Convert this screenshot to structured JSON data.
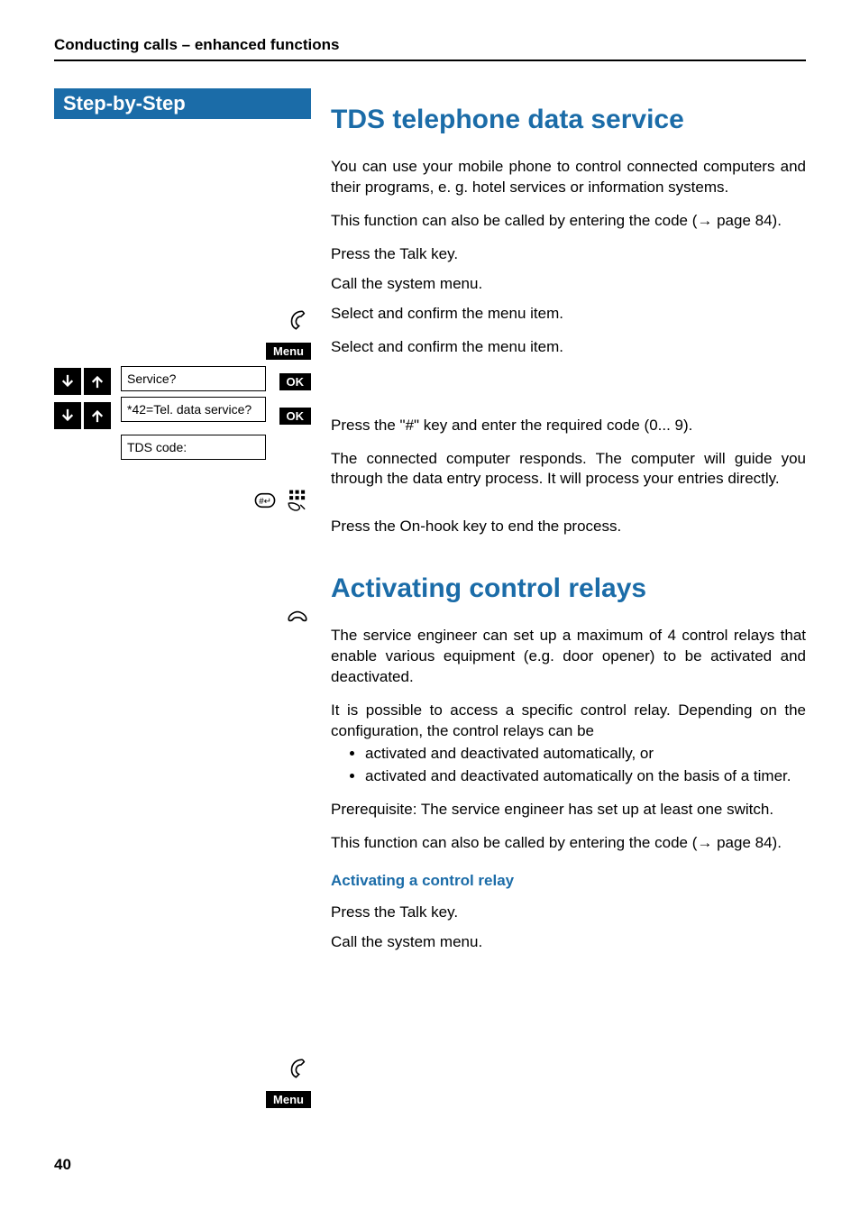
{
  "header": {
    "running_title": "Conducting calls – enhanced functions"
  },
  "left": {
    "step_by_step": "Step-by-Step",
    "menu_label": "Menu",
    "ok_label": "OK",
    "service_item": "Service?",
    "tel_data_item": "*42=Tel. data service?",
    "tds_code_item": "TDS code:"
  },
  "tds": {
    "title": "TDS telephone data service",
    "p1": "You can use your mobile phone to control connected computers and their programs, e. g. hotel services or information systems.",
    "p2_a": "This function can also be called by entering the code (",
    "p2_arrow": "→",
    "p2_b": " page 84).",
    "talk": "Press the Talk key.",
    "call_menu": "Call the system menu.",
    "select_confirm": "Select and confirm the menu item.",
    "hash": "Press the \"#\" key and enter the required code (0... 9).",
    "resp": "The connected computer responds. The computer will guide you through the data entry process. It will process your entries directly.",
    "onhook": "Press the On-hook key to end the process."
  },
  "relays": {
    "title": "Activating control relays",
    "p1": "The service engineer can set up a maximum of 4 control relays that enable various equipment (e.g. door opener) to be activated and deactivated.",
    "p2": "It is possible to access a specific control relay. Depending on the configuration, the control relays can be",
    "b1": "activated and deactivated automatically, or",
    "b2": "activated and deactivated automatically on the basis of a timer.",
    "p3": "Prerequisite: The service engineer has set up at least one switch.",
    "p4_a": "This function can also be called by entering the code (",
    "p4_arrow": "→",
    "p4_b": " page 84).",
    "sub": "Activating a control relay",
    "talk": "Press the Talk key.",
    "call_menu": "Call the system menu."
  },
  "page_number": "40"
}
